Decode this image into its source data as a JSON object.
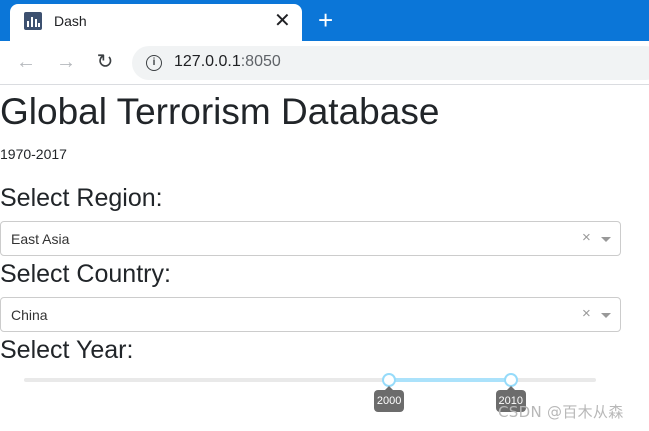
{
  "browser": {
    "tab_title": "Dash",
    "tab_close": "✕",
    "new_tab": "+",
    "url_host": "127.0.0.1",
    "url_port": ":8050",
    "back": "←",
    "forward": "→",
    "reload": "↻",
    "info": "i"
  },
  "page": {
    "title": "Global Terrorism Database",
    "subtitle": "1970-2017"
  },
  "region": {
    "label": "Select Region:",
    "value": "East Asia",
    "clear": "×"
  },
  "country": {
    "label": "Select Country:",
    "value": "China",
    "clear": "×"
  },
  "year": {
    "label": "Select Year:",
    "range": {
      "min": 1970,
      "max": 2017
    },
    "selected": [
      2000,
      2010
    ],
    "start_label": "2000",
    "end_label": "2010"
  },
  "watermark": "CSDN @百木从森",
  "colors": {
    "tab_bar": "#0b76d8",
    "slider_track": "#abe2fb",
    "slider_handle_border": "#96dbfa"
  }
}
